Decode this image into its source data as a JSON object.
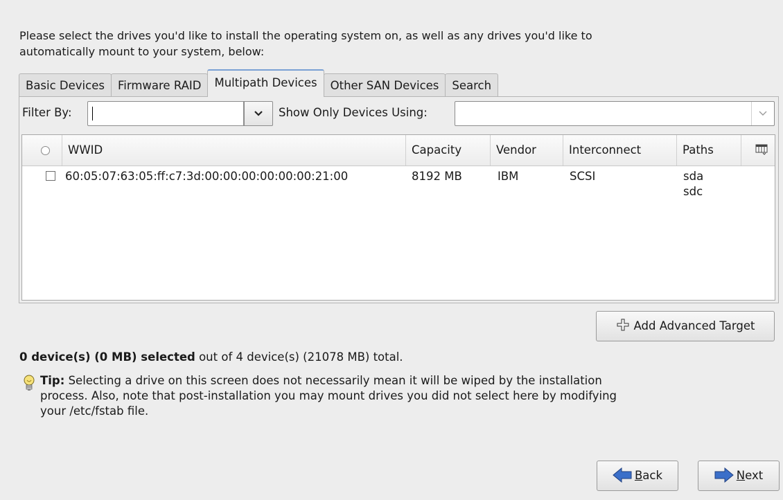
{
  "intro": "Please select the drives you'd like to install the operating system on, as well as any drives you'd like to automatically mount to your system, below:",
  "tabs": [
    {
      "label": "Basic Devices"
    },
    {
      "label": "Firmware RAID"
    },
    {
      "label": "Multipath Devices",
      "active": true
    },
    {
      "label": "Other SAN Devices"
    },
    {
      "label": "Search"
    }
  ],
  "filter": {
    "label": "Filter By:",
    "value": "",
    "show_label": "Show Only Devices Using:",
    "show_value": ""
  },
  "table": {
    "columns": [
      "WWID",
      "Capacity",
      "Vendor",
      "Interconnect",
      "Paths"
    ],
    "rows": [
      {
        "checked": false,
        "wwid": "60:05:07:63:05:ff:c7:3d:00:00:00:00:00:00:21:00",
        "capacity": "8192 MB",
        "vendor": "IBM",
        "interconnect": "SCSI",
        "paths": [
          "sda",
          "sdc"
        ]
      }
    ]
  },
  "add_target_button": "Add Advanced Target",
  "summary": {
    "bold": "0 device(s) (0 MB) selected",
    "rest": " out of 4 device(s) (21078 MB) total."
  },
  "tip": {
    "bold": "Tip:",
    "text": " Selecting a drive on this screen does not necessarily mean it will be wiped by the installation process.  Also, note that post-installation you may mount drives you did not select here by modifying your /etc/fstab file."
  },
  "nav": {
    "back_mnemonic": "B",
    "back_rest": "ack",
    "next_mnemonic": "N",
    "next_rest": "ext"
  },
  "colors": {
    "arrow_blue": "#3b6fc9",
    "tip_yellow": "#f3d34a"
  },
  "icons": [
    "column-chooser-icon",
    "plus-icon",
    "lightbulb-icon",
    "back-arrow-icon",
    "next-arrow-icon",
    "chevron-down-icon"
  ]
}
